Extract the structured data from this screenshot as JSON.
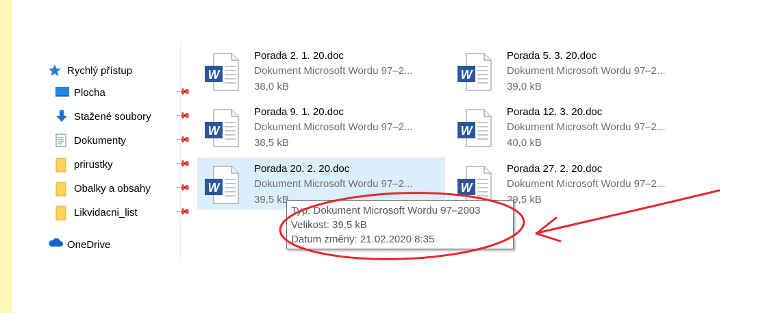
{
  "nav": {
    "items": [
      {
        "label": "Rychlý přístup",
        "icon": "star-icon",
        "pinned": false
      },
      {
        "label": "Plocha",
        "icon": "desktop-icon",
        "pinned": true
      },
      {
        "label": "Stažené soubory",
        "icon": "download-icon",
        "pinned": true
      },
      {
        "label": "Dokumenty",
        "icon": "documents-icon",
        "pinned": true
      },
      {
        "label": "prirustky",
        "icon": "folder-icon",
        "pinned": true
      },
      {
        "label": "Obalky a obsahy",
        "icon": "folder-icon",
        "pinned": true
      },
      {
        "label": "Likvidacni_list",
        "icon": "folder-icon",
        "pinned": true
      },
      {
        "label": "OneDrive",
        "icon": "cloud-icon",
        "pinned": false
      }
    ]
  },
  "files": [
    {
      "name": "Porada 2. 1. 20.doc",
      "type": "Dokument Microsoft Wordu 97–2...",
      "size": "38,0 kB"
    },
    {
      "name": "Porada 5. 3. 20.doc",
      "type": "Dokument Microsoft Wordu 97–2...",
      "size": "39,0 kB"
    },
    {
      "name": "Porada 9. 1. 20.doc",
      "type": "Dokument Microsoft Wordu 97–2...",
      "size": "38,5 kB"
    },
    {
      "name": "Porada 12. 3. 20.doc",
      "type": "Dokument Microsoft Wordu 97–2...",
      "size": "40,0 kB"
    },
    {
      "name": "Porada 20. 2. 20.doc",
      "type": "Dokument Microsoft Wordu 97–2...",
      "size": "39,5 kB",
      "selected": true
    },
    {
      "name": "Porada 27. 2. 20.doc",
      "type": "Dokument Microsoft Wordu 97–2...",
      "size": "39,5 kB"
    }
  ],
  "tooltip": {
    "type": "Typ: Dokument Microsoft Wordu 97–2003",
    "size": "Velikost: 39,5 kB",
    "modified": "Datum změny: 21.02.2020 8:35"
  },
  "colors": {
    "annotation": "#e8262b",
    "selection": "#dbeefb",
    "word_blue": "#2b579a",
    "sidebar_strip": "#fef9b4"
  }
}
